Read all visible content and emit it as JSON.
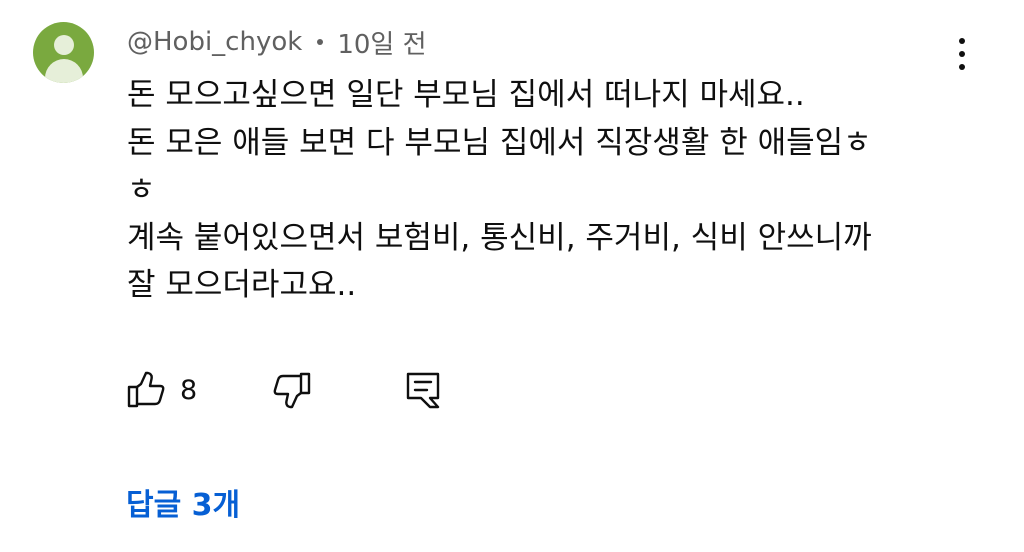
{
  "comment": {
    "author": "@Hobi_chyok",
    "time": "10일 전",
    "lines": [
      "돈 모으고싶으면 일단 부모님 집에서 떠나지 마세요..",
      "돈 모은 애들 보면 다 부모님 집에서 직장생활 한 애들임ㅎ",
      "ㅎ",
      "계속 붙어있으면서 보험비, 통신비, 주거비, 식비 안쓰니까",
      "잘 모으더라고요.."
    ],
    "like_count": "8",
    "replies_label": "답글 3개"
  },
  "icons": {
    "avatar": "avatar-icon",
    "more": "more-vertical-icon",
    "like": "thumbs-up-icon",
    "dislike": "thumbs-down-icon",
    "reply": "reply-icon"
  },
  "colors": {
    "avatar_bg": "#7aa93f",
    "meta_text": "#606060",
    "replies_link": "#065fd4",
    "text": "#0f0f0f"
  }
}
